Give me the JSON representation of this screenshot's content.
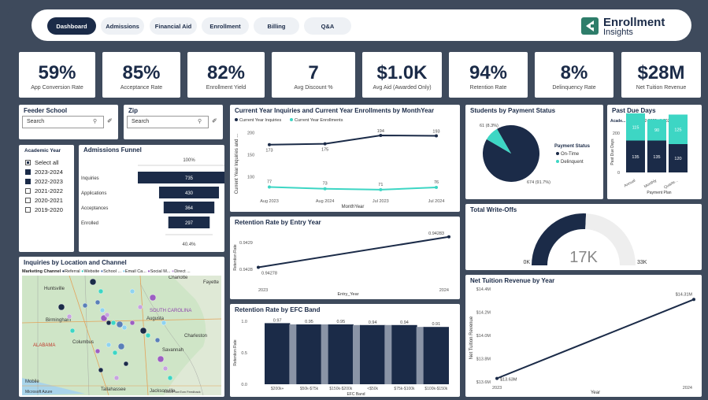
{
  "nav": {
    "tabs": [
      {
        "label": "Dashboard",
        "active": true
      },
      {
        "label": "Admissions",
        "active": false
      },
      {
        "label": "Financial Aid",
        "active": false
      },
      {
        "label": "Enrollment",
        "active": false
      },
      {
        "label": "Billing",
        "active": false
      },
      {
        "label": "Q&A",
        "active": false
      }
    ],
    "logo_line1": "Enrollment",
    "logo_line2": "Insights"
  },
  "kpis": [
    {
      "value": "59%",
      "label": "App Conversion Rate"
    },
    {
      "value": "85%",
      "label": "Acceptance Rate"
    },
    {
      "value": "82%",
      "label": "Enrollment Yield"
    },
    {
      "value": "7",
      "label": "Avg Discount %"
    },
    {
      "value": "$1.0K",
      "label": "Avg Aid (Awarded Only)"
    },
    {
      "value": "94%",
      "label": "Retention Rate"
    },
    {
      "value": "8%",
      "label": "Delinquency Rate"
    },
    {
      "value": "$28M",
      "label": "Net Tuition Revenue"
    }
  ],
  "feeder": {
    "title": "Feeder School",
    "placeholder": "Search"
  },
  "zip": {
    "title": "Zip",
    "placeholder": "Search"
  },
  "academic_year": {
    "title": "Academic Year",
    "items": [
      {
        "label": "Select all",
        "state": "partial"
      },
      {
        "label": "2023-2024",
        "state": "on"
      },
      {
        "label": "2022-2023",
        "state": "on"
      },
      {
        "label": "2021-2022",
        "state": "off"
      },
      {
        "label": "2020-2021",
        "state": "off"
      },
      {
        "label": "2019-2020",
        "state": "off"
      }
    ]
  },
  "map": {
    "title": "Inquiries by Location and Channel",
    "legend_title": "Marketing Channel",
    "legend": [
      "Referral",
      "Website",
      "School ...",
      "Email Ca...",
      "Social M...",
      "Direct ..."
    ],
    "places": [
      "Huntsville",
      "Birmingham",
      "ALABAMA",
      "Columbus",
      "Mobile",
      "Tallahassee",
      "Jacksonville",
      "Charlotte",
      "Fayette",
      "SOUTH CAROLINA",
      "Augusta",
      "Charleston",
      "Savannah"
    ],
    "attribution_left": "Microsoft Azure",
    "attribution_right": "©2025 TomTom Feedback"
  },
  "chart_data": [
    {
      "id": "funnel",
      "type": "bar",
      "title": "Admissions Funnel",
      "categories": [
        "Inquiries",
        "Applications",
        "Acceptances",
        "Enrolled"
      ],
      "values": [
        735,
        430,
        364,
        297
      ],
      "top_label": "100%",
      "bottom_label": "40.4%"
    },
    {
      "id": "inq_enroll",
      "type": "line",
      "title": "Current Year Inquiries and Current Year Enrollments by MonthYear",
      "categories": [
        "Aug 2023",
        "Aug 2024",
        "Jul 2023",
        "Jul 2024"
      ],
      "series": [
        {
          "name": "Current Year Inquiries",
          "values": [
            173,
            175,
            194,
            193
          ],
          "color": "#1b2b48"
        },
        {
          "name": "Current Year Enrollments",
          "values": [
            77,
            73,
            71,
            76
          ],
          "color": "#3dd6c4"
        }
      ],
      "xlabel": "MonthYear",
      "ylabel": "Current Year Inquiries and ...",
      "yticks": [
        100,
        150,
        200
      ]
    },
    {
      "id": "payment",
      "type": "pie",
      "title": "Students by Payment Status",
      "legend_title": "Payment Status",
      "slices": [
        {
          "name": "On-Time",
          "value": 674,
          "label": "674 (91.7%)",
          "color": "#1b2b48"
        },
        {
          "name": "Delinquent",
          "value": 61,
          "label": "61 (8.3%)",
          "color": "#3dd6c4"
        }
      ]
    },
    {
      "id": "pastdue",
      "type": "bar",
      "title": "Past Due Days",
      "legend_title": "Acade...",
      "categories": [
        "Annual",
        "Monthly",
        "Quarte..."
      ],
      "series": [
        {
          "name": "2022-2023",
          "values": [
            135,
            135,
            120
          ],
          "color": "#1b2b48"
        },
        {
          "name": "2023-2024",
          "values": [
            115,
            90,
            125
          ],
          "color": "#3dd6c4"
        }
      ],
      "xlabel": "Payment Plan",
      "ylabel": "Past Due Days",
      "yticks": [
        0,
        200
      ]
    },
    {
      "id": "retention_entry",
      "type": "line",
      "title": "Retention Rate by Entry Year",
      "x": [
        2023,
        2024
      ],
      "values": [
        0.94278,
        0.94283
      ],
      "point_labels": [
        "0.94278",
        "0.94283"
      ],
      "yticks": [
        "0.9428",
        "0.9429"
      ],
      "xlabel": "Entry_Year",
      "ylabel": "Retention Rate"
    },
    {
      "id": "writeoffs",
      "type": "gauge",
      "title": "Total Write-Offs",
      "value_label": "17K",
      "min_label": "0K",
      "max_label": "33K",
      "value": 17,
      "max": 33
    },
    {
      "id": "retention_efc",
      "type": "bar",
      "title": "Retention Rate by EFC Band",
      "categories": [
        "$200k+",
        "$50k-$75k",
        "$150k-$200k",
        "<$50k",
        "$75k-$100k",
        "$100k-$150k"
      ],
      "values": [
        0.97,
        0.95,
        0.95,
        0.94,
        0.94,
        0.91
      ],
      "value_labels": [
        "0.97",
        "0.95",
        "0.95",
        "0.94",
        "0.94",
        "0.91"
      ],
      "yticks": [
        "0.0",
        "0.5",
        "1.0"
      ],
      "xlabel": "EFC Band",
      "ylabel": "Retention Rate"
    },
    {
      "id": "ntr",
      "type": "line",
      "title": "Net Tuition Revenue by Year",
      "x": [
        2023,
        2024
      ],
      "values": [
        13.63,
        14.31
      ],
      "point_labels": [
        "$13.63M",
        "$14.31M"
      ],
      "yticks": [
        "$13.6M",
        "$13.8M",
        "$14.0M",
        "$14.2M",
        "$14.4M"
      ],
      "ytick_values": [
        13.6,
        13.8,
        14.0,
        14.2,
        14.4
      ],
      "xlabel": "Year",
      "ylabel": "Net Tuition Revenue"
    }
  ]
}
